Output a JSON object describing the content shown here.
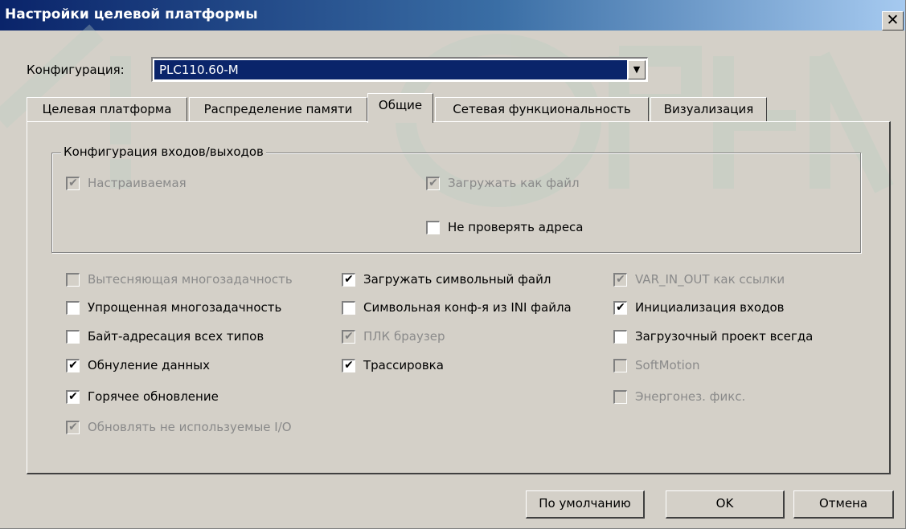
{
  "window": {
    "title": "Настройки целевой платформы",
    "close_glyph": "✕",
    "watermark": "ОВЕН"
  },
  "configuration": {
    "label": "Конфигурация:",
    "value": "PLC110.60-M",
    "arrow": "▼"
  },
  "tabs": [
    {
      "label": "Целевая платформа",
      "active": false
    },
    {
      "label": "Распределение памяти",
      "active": false
    },
    {
      "label": "Общие",
      "active": true
    },
    {
      "label": "Сетевая функциональность",
      "active": false
    },
    {
      "label": "Визуализация",
      "active": false
    }
  ],
  "io_group": {
    "title": "Конфигурация входов/выходов",
    "items": [
      {
        "label": "Настраиваемая",
        "checked": true,
        "enabled": false
      },
      {
        "label": "Загружать как файл",
        "checked": true,
        "enabled": false
      },
      {
        "label": "Не проверять адреса",
        "checked": false,
        "enabled": true
      }
    ]
  },
  "options": {
    "col1": [
      {
        "label": "Вытесняющая многозадачность",
        "checked": false,
        "enabled": false
      },
      {
        "label": "Упрощенная многозадачность",
        "checked": false,
        "enabled": true
      },
      {
        "label": "Байт-адресация всех типов",
        "checked": false,
        "enabled": true
      },
      {
        "label": "Обнуление данных",
        "checked": true,
        "enabled": true
      },
      {
        "label": "Горячее обновление",
        "checked": true,
        "enabled": true
      },
      {
        "label": "Обновлять не используемые I/O",
        "checked": true,
        "enabled": false
      }
    ],
    "col2": [
      {
        "label": "Загружать символьный файл",
        "checked": true,
        "enabled": true
      },
      {
        "label": "Символьная конф-я из INI файла",
        "checked": false,
        "enabled": true
      },
      {
        "label": "ПЛК браузер",
        "checked": true,
        "enabled": false
      },
      {
        "label": "Трассировка",
        "checked": true,
        "enabled": true
      }
    ],
    "col3": [
      {
        "label": "VAR_IN_OUT как ссылки",
        "checked": true,
        "enabled": false
      },
      {
        "label": "Инициализация входов",
        "checked": true,
        "enabled": true
      },
      {
        "label": "Загрузочный проект всегда",
        "checked": false,
        "enabled": true
      },
      {
        "label": "SoftMotion",
        "checked": false,
        "enabled": false
      },
      {
        "label": "Энергонез. фикс.",
        "checked": false,
        "enabled": false
      }
    ]
  },
  "buttons": {
    "default": "По умолчанию",
    "ok": "OK",
    "cancel": "Отмена"
  },
  "check_glyph": "✔"
}
